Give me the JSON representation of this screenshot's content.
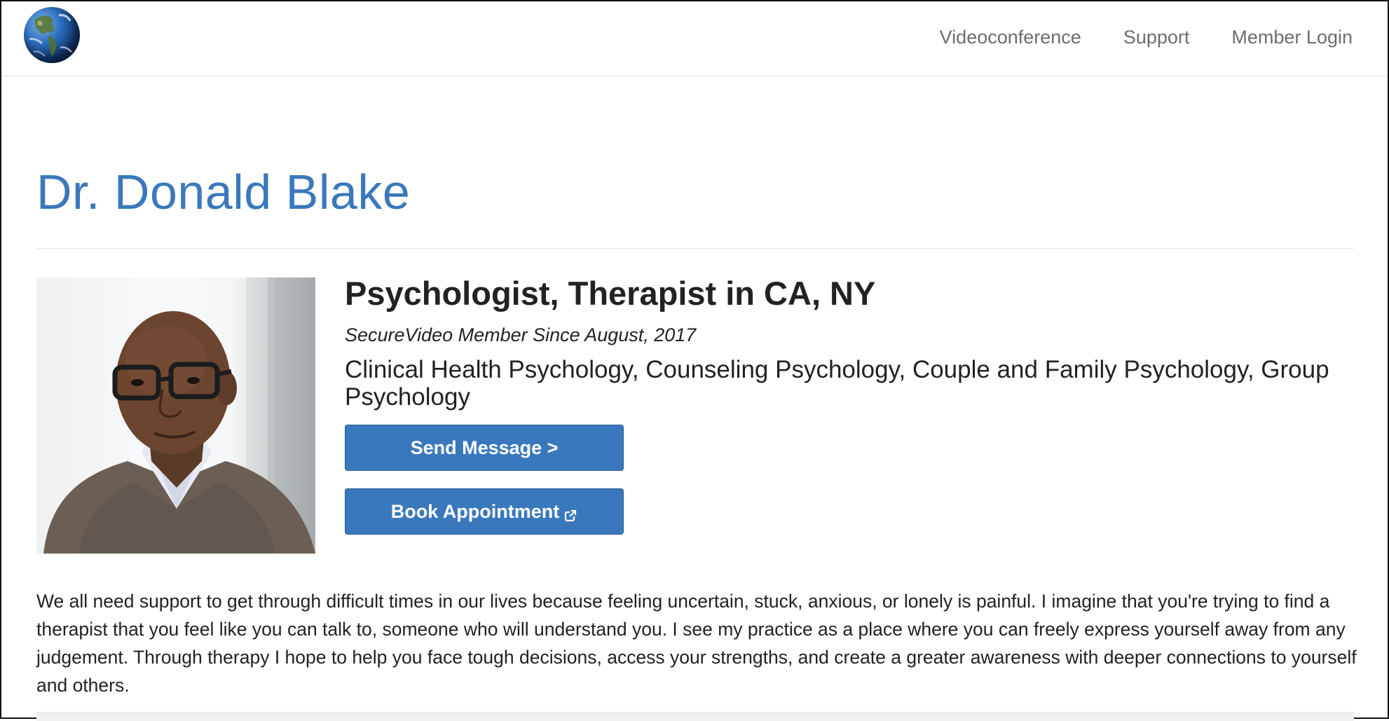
{
  "header": {
    "logo_icon": "earth-globe-icon",
    "nav": [
      {
        "label": "Videoconference"
      },
      {
        "label": "Support"
      },
      {
        "label": "Member Login"
      }
    ]
  },
  "profile": {
    "name": "Dr. Donald Blake",
    "profession": "Psychologist, Therapist in CA, NY",
    "member_since": "SecureVideo Member Since August, 2017",
    "specialties": "Clinical Health Psychology, Counseling Psychology, Couple and Family Psychology, Group Psychology",
    "photo_icon": "profile-photo",
    "send_message_label": "Send Message >",
    "book_appointment_label": "Book Appointment",
    "book_icon": "external-link-icon",
    "bio": "We all need support to get through difficult times in our lives because feeling uncertain, stuck, anxious, or lonely is painful. I imagine that you're trying to find a therapist that you feel like you can talk to, someone who will understand you. I see my practice as a place where you can freely express yourself away from any judgement. Through therapy I hope to help you face tough decisions, access your strengths, and create a greater awareness with deeper connections to yourself and others."
  },
  "colors": {
    "accent": "#3a78bd",
    "nav_text": "#6d6d6d",
    "text": "#222222"
  }
}
